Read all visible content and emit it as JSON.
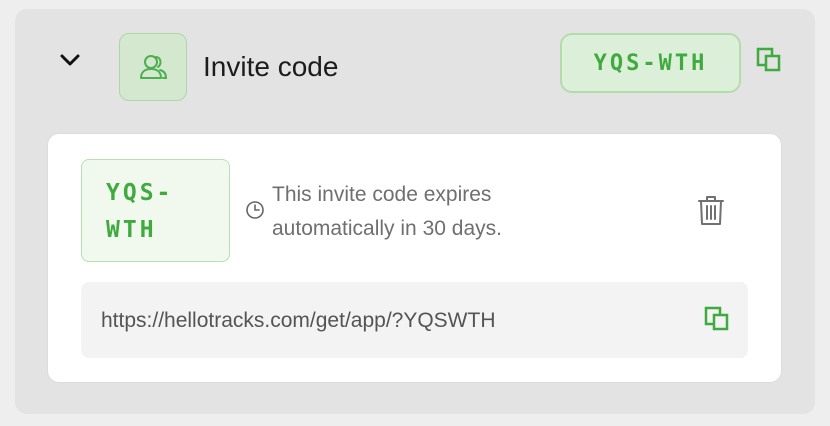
{
  "section": {
    "title": "Invite code",
    "code": "YQS-WTH",
    "collapse_icon": "chevron-down-icon",
    "group_icon": "users-icon",
    "copy_icon": "copy-icon"
  },
  "details": {
    "code_line1": "YQS-",
    "code_line2": "WTH",
    "expiry_text": "This invite code expires automatically in 30 days.",
    "clock_icon": "clock-icon",
    "delete_icon": "trash-icon",
    "link": "https://hellotracks.com/get/app/?YQSWTH",
    "link_copy_icon": "copy-icon"
  },
  "colors": {
    "accent_green": "#3faa3d",
    "code_bg": "#dcefd8",
    "card_bg": "#e3e3e3",
    "panel_bg": "#ffffff"
  }
}
